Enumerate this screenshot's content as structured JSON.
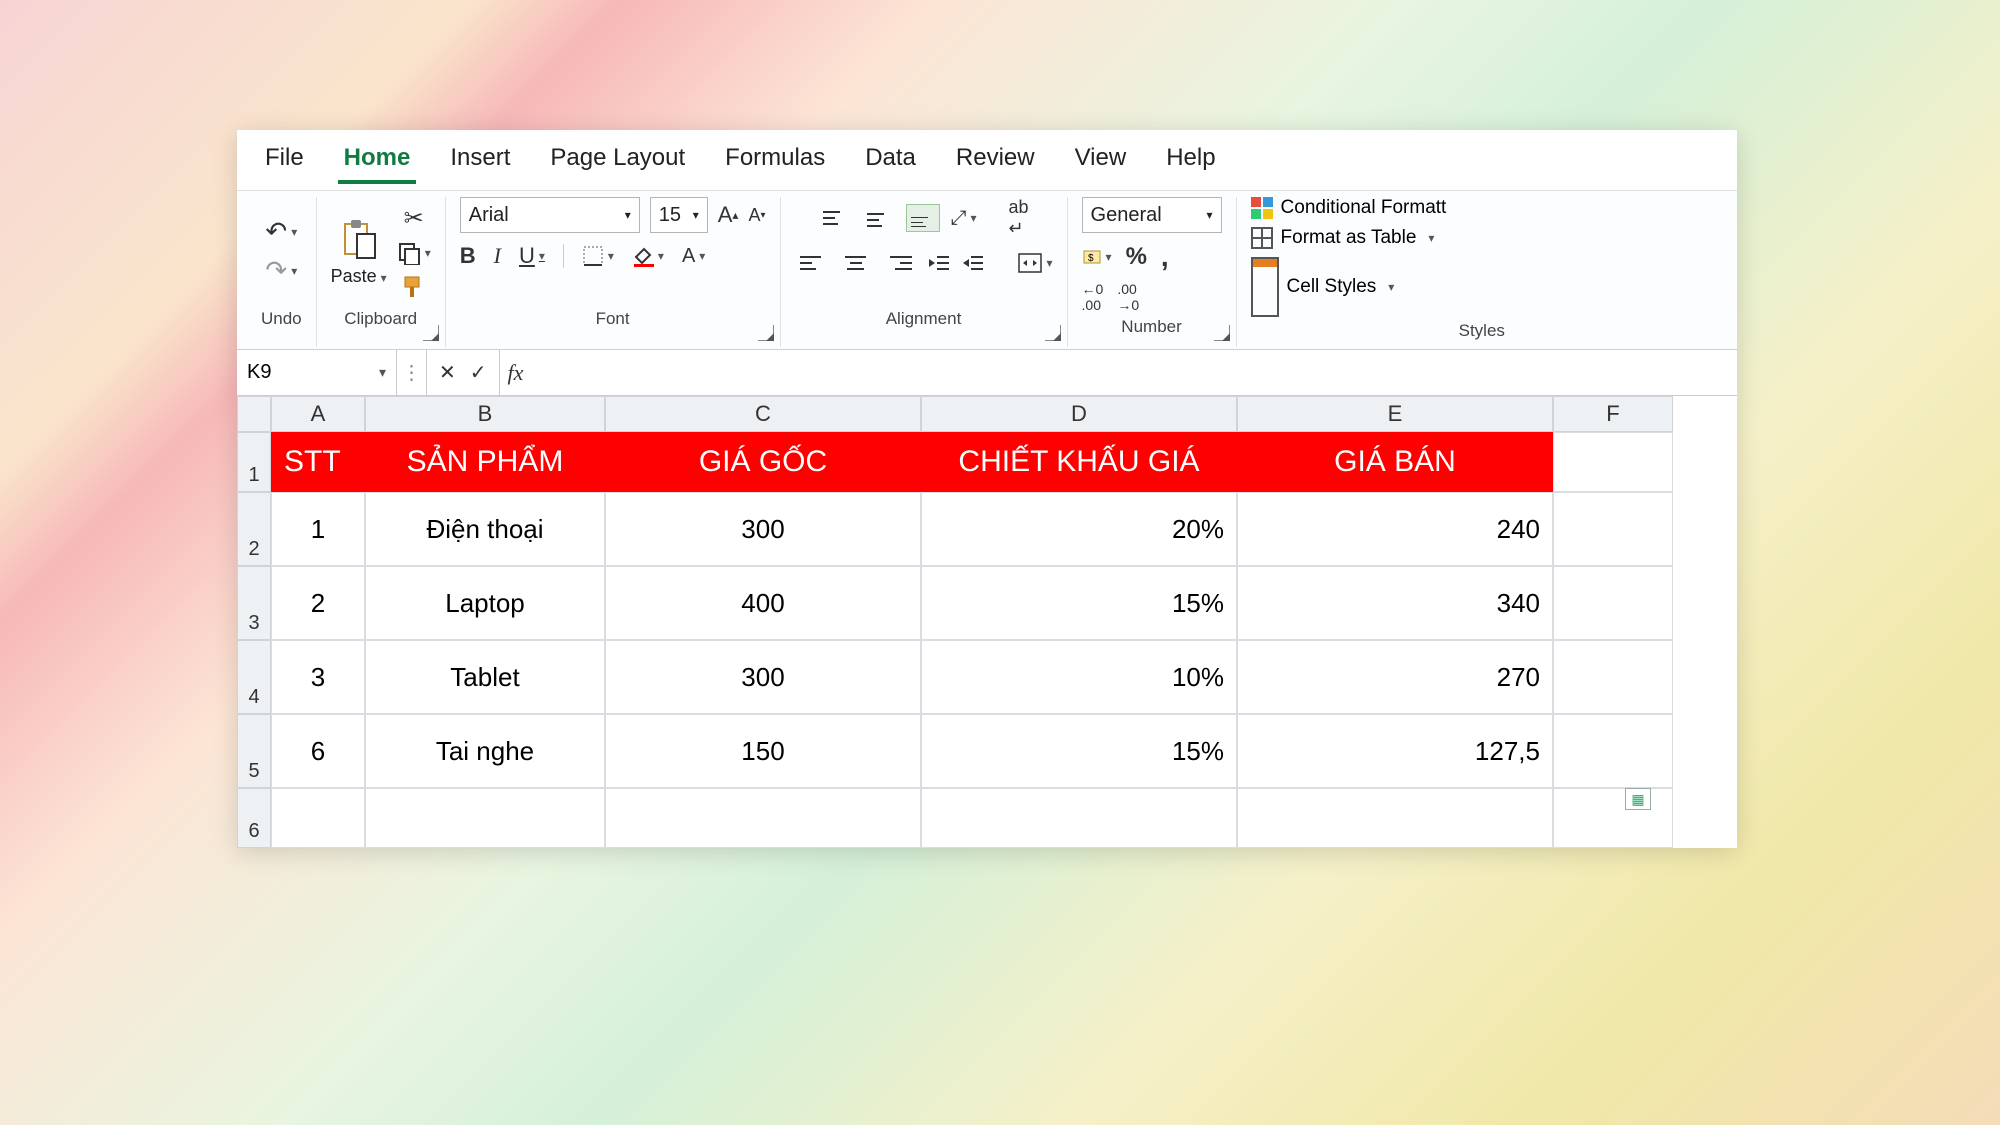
{
  "menu": {
    "file": "File",
    "home": "Home",
    "insert": "Insert",
    "layout": "Page Layout",
    "formulas": "Formulas",
    "data": "Data",
    "review": "Review",
    "view": "View",
    "help": "Help"
  },
  "ribbon": {
    "undo_label": "Undo",
    "clipboard_label": "Clipboard",
    "paste_label": "Paste",
    "font_label": "Font",
    "font_name": "Arial",
    "font_size": "15",
    "alignment_label": "Alignment",
    "number_label": "Number",
    "number_format": "General",
    "styles_label": "Styles",
    "cond_fmt": "Conditional Formatt",
    "fmt_table": "Format as Table",
    "cell_styles": "Cell Styles"
  },
  "formula_bar": {
    "namebox": "K9",
    "fx": "fx",
    "value": ""
  },
  "columns": [
    "A",
    "B",
    "C",
    "D",
    "E",
    "F"
  ],
  "row_headers": [
    "1",
    "2",
    "3",
    "4",
    "5",
    "6"
  ],
  "headers": {
    "stt": "STT",
    "sp": "SẢN PHẨM",
    "gia": "GIÁ GỐC",
    "ck": "CHIẾT KHẤU GIÁ",
    "ban": "GIÁ BÁN"
  },
  "rows": [
    {
      "stt": "1",
      "sp": "Điện thoại",
      "gia": "300",
      "ck": "20%",
      "ban": "240"
    },
    {
      "stt": "2",
      "sp": "Laptop",
      "gia": "400",
      "ck": "15%",
      "ban": "340"
    },
    {
      "stt": "3",
      "sp": "Tablet",
      "gia": "300",
      "ck": "10%",
      "ban": "270"
    },
    {
      "stt": "6",
      "sp": "Tai nghe",
      "gia": "150",
      "ck": "15%",
      "ban": "127,5"
    }
  ],
  "colors": {
    "header_bg": "#ff0000",
    "accent": "#107c41"
  }
}
